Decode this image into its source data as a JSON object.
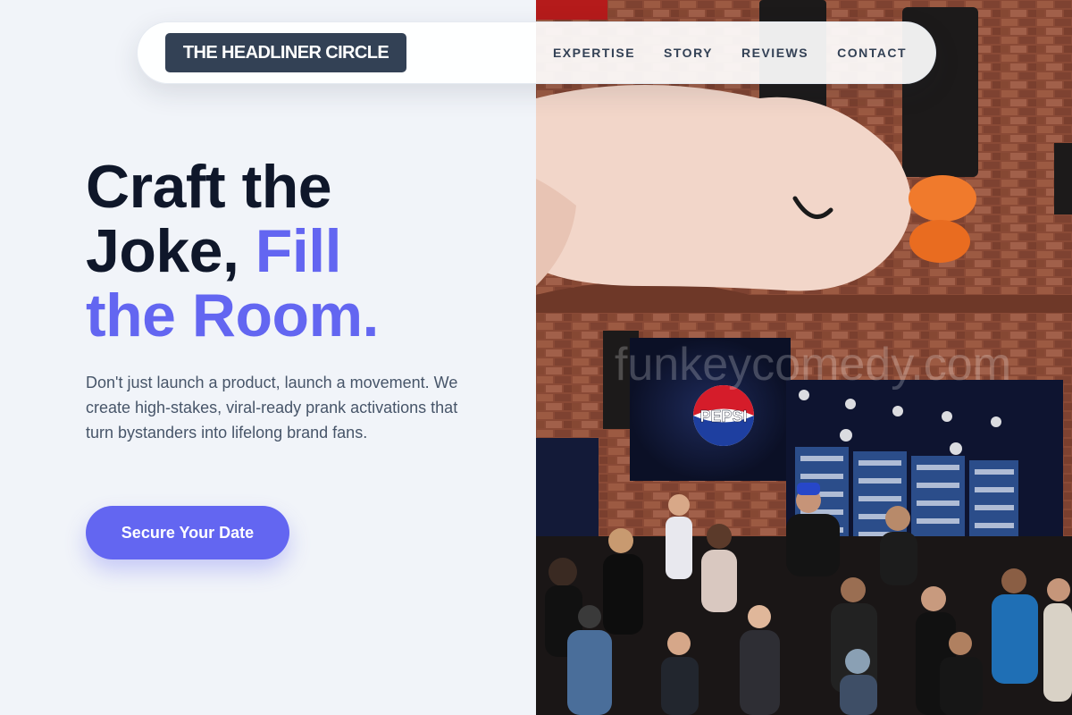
{
  "nav": {
    "brand": "THE HEADLINER CIRCLE",
    "links": [
      "EXPERTISE",
      "STORY",
      "REVIEWS",
      "CONTACT"
    ]
  },
  "hero": {
    "title_line1": "Craft the",
    "title_line2": "Joke, ",
    "title_accent_a": "Fill",
    "title_accent_b": "the Room.",
    "subtitle": "Don't just launch a product, launch a movement. We create high-stakes, viral-ready prank activations that turn bystanders into lifelong brand fans.",
    "cta_label": "Secure Your Date"
  },
  "photo": {
    "icon": "event-crowd-photo",
    "brand_logo_text": "PEPSI",
    "watermark": "funkeycomedy.com"
  },
  "colors": {
    "accent": "#6366f1",
    "heading": "#0f172a",
    "brand_bg": "#334155",
    "background": "#f1f4f9"
  }
}
